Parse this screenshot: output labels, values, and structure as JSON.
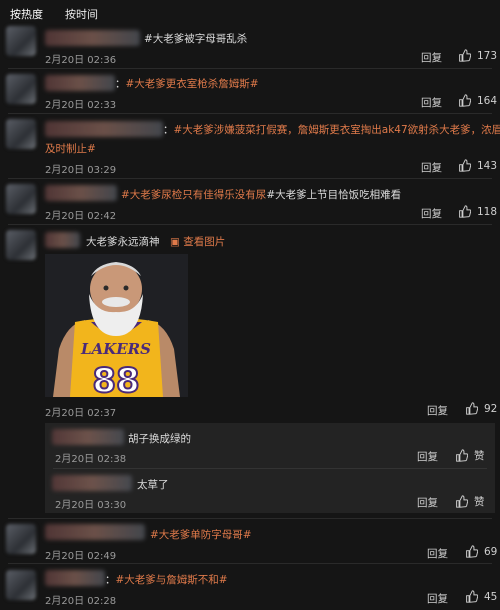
{
  "sort": {
    "hot": "按热度",
    "time": "按时间"
  },
  "labels": {
    "reply": "回复",
    "view_image": "查看图片"
  },
  "comments": [
    {
      "line1_prefix": "",
      "line1_tag": "#大老爹被字母哥乱杀",
      "line2": "",
      "date": "2月20日 02:36",
      "likes": "173"
    },
    {
      "line1_prefix": "：",
      "line1_tag": "#大老爹更衣室枪杀詹姆斯#",
      "line2": "",
      "date": "2月20日 02:33",
      "likes": "164"
    },
    {
      "line1_prefix": "：",
      "line1_tag": "#大老爹涉嫌菠菜打假赛，詹姆斯更衣室掏出ak47欲射杀大老爹，浓眉",
      "line2": "及时制止#",
      "date": "2月20日 03:29",
      "likes": "143"
    },
    {
      "line1_prefix": "",
      "line1_tag": "#大老爹尿检只有佳得乐没有尿",
      "line1_suffix": "#大老爹上节目恰饭吃相难看",
      "line2": "",
      "date": "2月20日 02:42",
      "likes": "118"
    },
    {
      "line1_prefix": "大老爹永远滴神",
      "line1_tag": "",
      "line2": "",
      "date": "2月20日 02:37",
      "likes": "92",
      "image": {
        "team_text": "LAKERS",
        "number": "88"
      },
      "replies": [
        {
          "text": "胡子换成绿的",
          "date": "2月20日 02:38"
        },
        {
          "text": "太草了",
          "date": "2月20日 03:30"
        }
      ]
    },
    {
      "line1_prefix": "",
      "line1_tag": "#大老爹单防字母哥#",
      "line2": "",
      "date": "2月20日 02:49",
      "likes": "69"
    },
    {
      "line1_prefix": "：",
      "line1_tag": "#大老爹与詹姆斯不和#",
      "line2": "",
      "date": "2月20日 02:28",
      "likes": "45"
    }
  ]
}
